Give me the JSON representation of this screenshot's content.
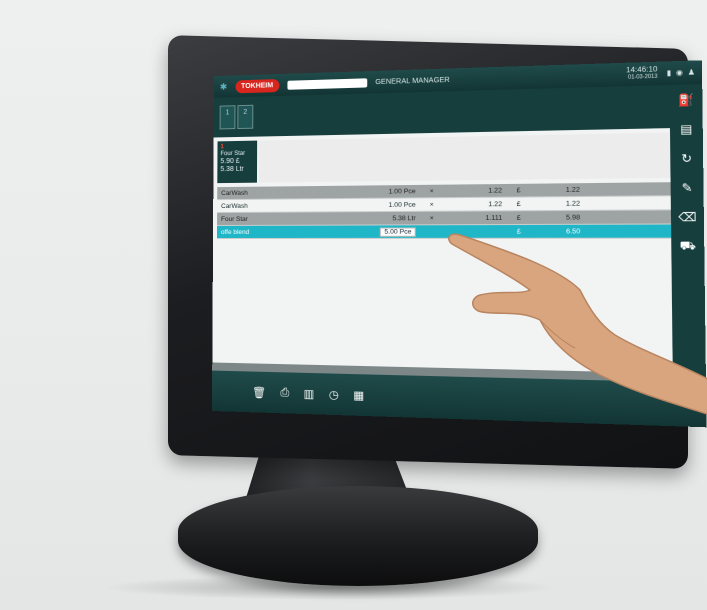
{
  "header": {
    "logo": "TOKHEIM",
    "role": "GENERAL MANAGER",
    "time": "14:46:10",
    "date": "01-03-2013"
  },
  "dock": {
    "tabs": [
      "1",
      "2"
    ]
  },
  "product_card": {
    "index": "1",
    "name": "Four Star",
    "price": "5.90 £",
    "volume": "5.38 Ltr"
  },
  "receipt": {
    "rows": [
      {
        "name": "CarWash",
        "qty": "1.00 Pce",
        "mul": "×",
        "unit": "1.22",
        "cur": "£",
        "total": "1.22"
      },
      {
        "name": "CarWash",
        "qty": "1.00 Pce",
        "mul": "×",
        "unit": "1.22",
        "cur": "£",
        "total": "1.22"
      },
      {
        "name": "Four Star",
        "qty": "5.38 Ltr",
        "mul": "×",
        "unit": "1.111",
        "cur": "£",
        "total": "5.98"
      },
      {
        "name": "offe blend",
        "qty": "5.00 Pce",
        "mul": "",
        "unit": "",
        "cur": "£",
        "total": "6.50"
      }
    ]
  },
  "sidebar": {
    "icons": [
      "fuel-pump-icon",
      "receipt-icon",
      "refresh-icon",
      "edit-icon",
      "delete-icon",
      "cart-icon"
    ]
  },
  "bottombar": {
    "icons": [
      "trash-icon",
      "print-icon",
      "receipt-icon",
      "clock-icon",
      "calculator-icon"
    ]
  },
  "colors": {
    "accent": "#1fb6c7",
    "dark": "#163e3d",
    "logo": "#d8261f"
  }
}
